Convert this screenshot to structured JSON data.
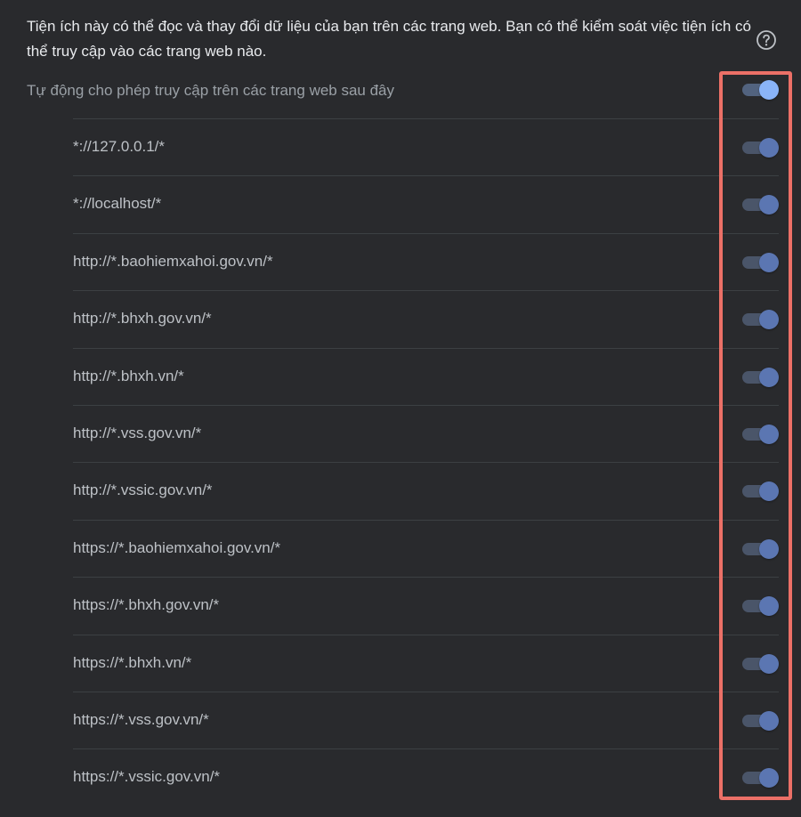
{
  "description": "Tiện ích này có thể đọc và thay đổi dữ liệu của bạn trên các trang web. Bạn có thể kiểm soát việc tiện ích có thể truy cập vào các trang web nào.",
  "help_icon": "help-circle-icon",
  "auto_allow": {
    "label": "Tự động cho phép truy cập trên các trang web sau đây",
    "enabled": true
  },
  "sites": [
    {
      "pattern": "*://127.0.0.1/*",
      "enabled": true
    },
    {
      "pattern": "*://localhost/*",
      "enabled": true
    },
    {
      "pattern": "http://*.baohiemxahoi.gov.vn/*",
      "enabled": true
    },
    {
      "pattern": "http://*.bhxh.gov.vn/*",
      "enabled": true
    },
    {
      "pattern": "http://*.bhxh.vn/*",
      "enabled": true
    },
    {
      "pattern": "http://*.vss.gov.vn/*",
      "enabled": true
    },
    {
      "pattern": "http://*.vssic.gov.vn/*",
      "enabled": true
    },
    {
      "pattern": "https://*.baohiemxahoi.gov.vn/*",
      "enabled": true
    },
    {
      "pattern": "https://*.bhxh.gov.vn/*",
      "enabled": true
    },
    {
      "pattern": "https://*.bhxh.vn/*",
      "enabled": true
    },
    {
      "pattern": "https://*.vss.gov.vn/*",
      "enabled": true
    },
    {
      "pattern": "https://*.vssic.gov.vn/*",
      "enabled": true
    }
  ],
  "colors": {
    "background": "#292a2d",
    "toggle_on_knob": "#8ab4f8",
    "toggle_dim_knob": "#5b76b2",
    "highlight": "#ec7067"
  }
}
